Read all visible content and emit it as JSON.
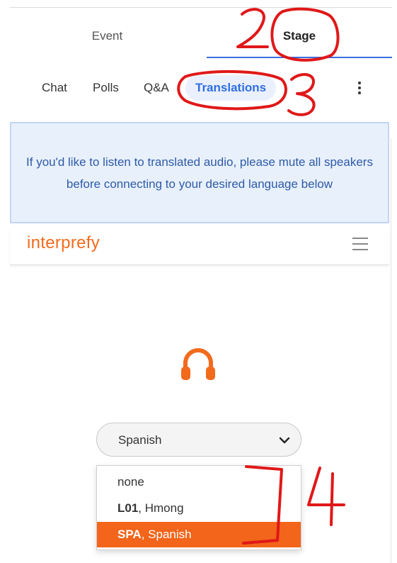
{
  "main_tabs": [
    {
      "label": "Event",
      "active": false
    },
    {
      "label": "Stage",
      "active": true
    }
  ],
  "sub_tabs": [
    {
      "label": "Chat"
    },
    {
      "label": "Polls"
    },
    {
      "label": "Q&A"
    },
    {
      "label": "Translations",
      "active": true
    }
  ],
  "info": {
    "text": "If you'd like to listen to translated audio, please mute all speakers before connecting to your desired language below"
  },
  "interprefy": {
    "logo": "interprefy",
    "menu_icon": "hamburger-icon",
    "audio_icon": "headphones-icon"
  },
  "language_select": {
    "value": "Spanish",
    "options": [
      {
        "code": "",
        "name": "none"
      },
      {
        "code": "L01",
        "name": ", Hmong"
      },
      {
        "code": "SPA",
        "name": ", Spanish",
        "selected": true
      }
    ]
  },
  "annotations": [
    "2",
    "3",
    "4"
  ],
  "colors": {
    "accent_blue": "#3b6fe0",
    "brand_orange": "#f26b1d",
    "annotation_red": "#e01818",
    "info_bg": "#e8f0fc"
  }
}
